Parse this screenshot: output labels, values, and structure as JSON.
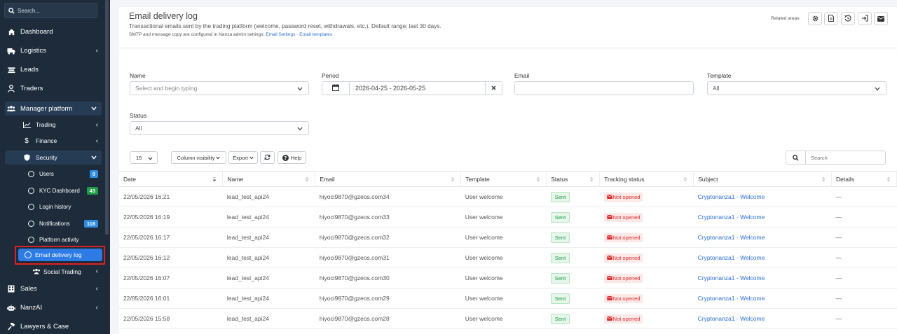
{
  "sidebar": {
    "search_placeholder": "Search...",
    "items": [
      {
        "label": "Dashboard"
      },
      {
        "label": "Logistics"
      },
      {
        "label": "Leads"
      },
      {
        "label": "Traders"
      },
      {
        "label": "Manager platform"
      },
      {
        "label": "Trading"
      },
      {
        "label": "Finance"
      },
      {
        "label": "Security"
      },
      {
        "label": "Users",
        "badge": "0"
      },
      {
        "label": "KYC Dashboard",
        "badge": "43"
      },
      {
        "label": "Login history"
      },
      {
        "label": "Notifications",
        "badge": "116"
      },
      {
        "label": "Platform activity"
      },
      {
        "label": "Email delivery log"
      },
      {
        "label": "Social Trading"
      },
      {
        "label": "Sales"
      },
      {
        "label": "NanzAI"
      },
      {
        "label": "Lawyers & Case"
      }
    ]
  },
  "header": {
    "title": "Email delivery log",
    "description": "Transactional emails sent by the trading platform (welcome, password reset, withdrawals, etc.). Default range: last 30 days.",
    "note_prefix": "SMTP and message copy are configured in Nanza admin settings: ",
    "link_settings": "Email Settings",
    "link_sep": " · ",
    "link_templates": "Email templates",
    "related_label": "Related areas:"
  },
  "filters": {
    "name_label": "Name",
    "name_placeholder": "Select and begin typing",
    "period_label": "Period",
    "period_value": "2026-04-25 - 2026-05-25",
    "email_label": "Email",
    "email_value": "",
    "template_label": "Template",
    "template_value": "All",
    "status_label": "Status",
    "status_value": "All"
  },
  "toolbar": {
    "page_size": "15",
    "column_visibility": "Column visibility",
    "export": "Export",
    "help": "Help",
    "search_placeholder": "Search"
  },
  "table": {
    "columns": [
      "Date",
      "Name",
      "Email",
      "Template",
      "Status",
      "Tracking status",
      "Subject",
      "Details"
    ],
    "rows": [
      {
        "date": "22/05/2026 16:21",
        "name": "lead_test_api24",
        "email": "hiyoci9870@gzeos.com34",
        "template": "User welcome",
        "status": "Sent",
        "tracking": "Not opened",
        "subject": "Cryptonanza1 - Welcome",
        "details": "—"
      },
      {
        "date": "22/05/2026 16:19",
        "name": "lead_test_api24",
        "email": "hiyoci9870@gzeos.com33",
        "template": "User welcome",
        "status": "Sent",
        "tracking": "Not opened",
        "subject": "Cryptonanza1 - Welcome",
        "details": "—"
      },
      {
        "date": "22/05/2026 16:17",
        "name": "lead_test_api24",
        "email": "hiyoci9870@gzeos.com32",
        "template": "User welcome",
        "status": "Sent",
        "tracking": "Not opened",
        "subject": "Cryptonanza1 - Welcome",
        "details": "—"
      },
      {
        "date": "22/05/2026 16:12",
        "name": "lead_test_api24",
        "email": "hiyoci9870@gzeos.com31",
        "template": "User welcome",
        "status": "Sent",
        "tracking": "Not opened",
        "subject": "Cryptonanza1 - Welcome",
        "details": "—"
      },
      {
        "date": "22/05/2026 16:07",
        "name": "lead_test_api24",
        "email": "hiyoci9870@gzeos.com30",
        "template": "User welcome",
        "status": "Sent",
        "tracking": "Not opened",
        "subject": "Cryptonanza1 - Welcome",
        "details": "—"
      },
      {
        "date": "22/05/2026 16:01",
        "name": "lead_test_api24",
        "email": "hiyoci9870@gzeos.com29",
        "template": "User welcome",
        "status": "Sent",
        "tracking": "Not opened",
        "subject": "Cryptonanza1 - Welcome",
        "details": "—"
      },
      {
        "date": "22/05/2026 15:58",
        "name": "lead_test_api24",
        "email": "hiyoci9870@gzeos.com28",
        "template": "User welcome",
        "status": "Sent",
        "tracking": "Not opened",
        "subject": "Cryptonanza1 - Welcome",
        "details": "—"
      }
    ]
  },
  "colors": {
    "sidebar_bg": "#1d2b3a",
    "accent": "#2d7be5",
    "link": "#2d6fd6",
    "highlight_border": "#e02020",
    "sent_green": "#1f9d44",
    "not_opened_red": "#d92b2b"
  }
}
